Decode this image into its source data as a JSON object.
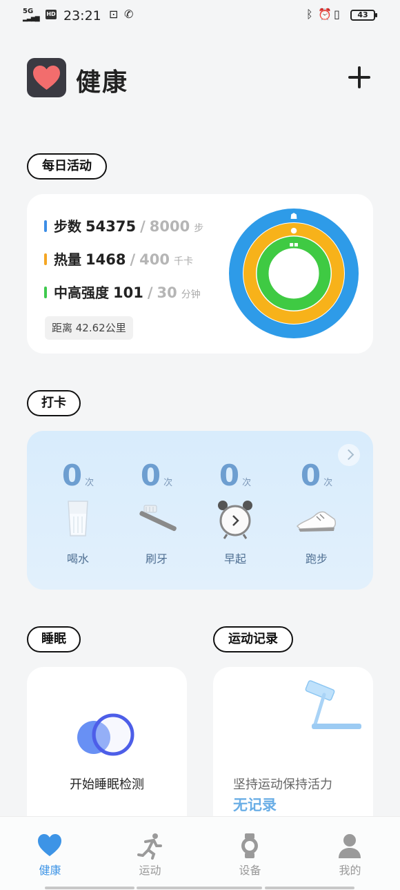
{
  "status_bar": {
    "network": "5G",
    "hd_badge": "HD",
    "time": "23:21",
    "battery": "43"
  },
  "header": {
    "title": "健康"
  },
  "daily_activity": {
    "section_title": "每日活动",
    "steps": {
      "label": "步数",
      "value": "54375",
      "separator": "/",
      "goal": "8000",
      "unit": "步",
      "color": "#3d8ee6"
    },
    "calories": {
      "label": "热量",
      "value": "1468",
      "separator": "/",
      "goal": "400",
      "unit": "千卡",
      "color": "#f5a623"
    },
    "intensity": {
      "label": "中高强度",
      "value": "101",
      "separator": "/",
      "goal": "30",
      "unit": "分钟",
      "color": "#3ec94e"
    },
    "distance": "距离  42.62公里"
  },
  "checkin": {
    "section_title": "打卡",
    "items": [
      {
        "count": "0",
        "unit": "次",
        "name": "喝水",
        "icon": "water-glass-icon"
      },
      {
        "count": "0",
        "unit": "次",
        "name": "刷牙",
        "icon": "toothbrush-icon"
      },
      {
        "count": "0",
        "unit": "次",
        "name": "早起",
        "icon": "alarm-clock-icon"
      },
      {
        "count": "0",
        "unit": "次",
        "name": "跑步",
        "icon": "running-shoe-icon"
      }
    ]
  },
  "sleep": {
    "section_title": "睡眠",
    "action": "开始睡眠检测"
  },
  "sport_record": {
    "section_title": "运动记录",
    "hint": "坚持运动保持活力",
    "status": "无记录"
  },
  "bottom_nav": [
    {
      "label": "健康",
      "icon": "heart-icon",
      "active": true
    },
    {
      "label": "运动",
      "icon": "runner-icon",
      "active": false
    },
    {
      "label": "设备",
      "icon": "watch-icon",
      "active": false
    },
    {
      "label": "我的",
      "icon": "person-icon",
      "active": false
    }
  ]
}
